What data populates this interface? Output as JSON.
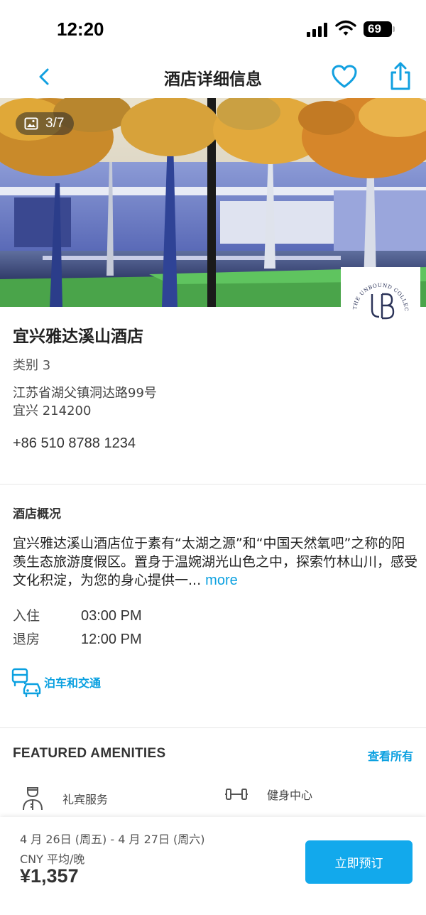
{
  "status_bar": {
    "time": "12:20",
    "battery_level": "69"
  },
  "nav": {
    "title": "酒店详细信息",
    "back_icon": "chevron-left-icon",
    "favorite_icon": "heart-icon",
    "share_icon": "share-icon"
  },
  "hero": {
    "photo_counter": "3/7",
    "brand_logo_text": "THE UNBOUND COLLECTION BY HYATT"
  },
  "hotel": {
    "name": "宜兴雅达溪山酒店",
    "category": "类别 3",
    "address_line1": "江苏省湖父镇洞达路99号",
    "address_line2": "宜兴 214200",
    "phone": "+86 510 8788 1234"
  },
  "overview": {
    "title": "酒店概况",
    "description": "宜兴雅达溪山酒店位于素有“太湖之源”和“中国天然氧吧”之称的阳羡生态旅游度假区。置身于温婉湖光山色之中，探索竹林山川，感受文化积淀，为您的身心提供一...",
    "more_label": "more",
    "checkin_label": "入住",
    "checkin_time": "03:00 PM",
    "checkout_label": "退房",
    "checkout_time": "12:00 PM",
    "parking_label": "泊车和交通"
  },
  "amenities": {
    "title": "FEATURED AMENITIES",
    "view_all_label": "查看所有",
    "items": [
      {
        "label": "礼宾服务",
        "icon": "concierge-icon"
      },
      {
        "label": "健身中心",
        "icon": "dumbbell-icon"
      }
    ]
  },
  "booking": {
    "dates": "4 月 26日 (周五) - 4 月 27日 (周六)",
    "price_unit": "CNY 平均/晚",
    "price": "¥1,357",
    "book_label": "立即预订"
  },
  "colors": {
    "accent": "#12a9ec",
    "link": "#0aa0e0",
    "text": "#222222"
  }
}
